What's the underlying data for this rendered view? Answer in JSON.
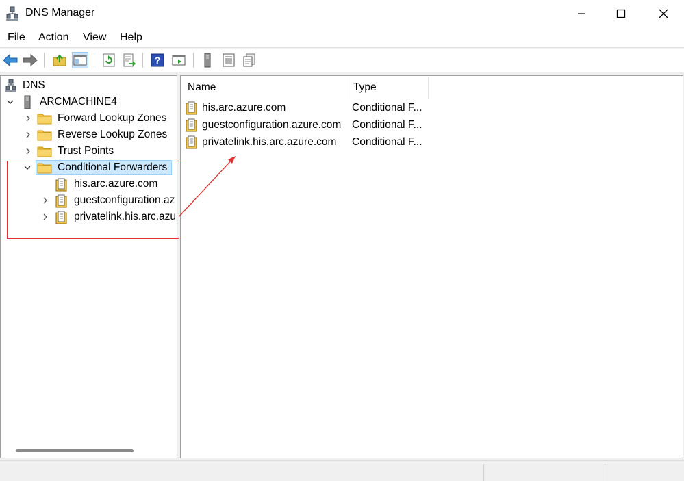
{
  "window": {
    "title": "DNS Manager",
    "controls": {
      "minimize": "—",
      "maximize": "☐",
      "close": "✕"
    }
  },
  "menu": [
    "File",
    "Action",
    "View",
    "Help"
  ],
  "toolbar": {
    "buttons": [
      "back-arrow-icon",
      "forward-arrow-icon",
      "up-folder-icon",
      "show-hide-tree-icon",
      "refresh-icon",
      "export-list-icon",
      "help-icon",
      "action-pane-icon",
      "server-icon",
      "list-icon",
      "properties-icon"
    ]
  },
  "tree": {
    "root": "DNS",
    "server": "ARCMACHINE4",
    "nodes": [
      "Forward Lookup Zones",
      "Reverse Lookup Zones",
      "Trust Points",
      "Conditional Forwarders"
    ],
    "forwarders": [
      "his.arc.azure.com",
      "guestconfiguration.az",
      "privatelink.his.arc.azur"
    ]
  },
  "list": {
    "columns": [
      "Name",
      "Type"
    ],
    "rows": [
      {
        "name": "his.arc.azure.com",
        "type": "Conditional F..."
      },
      {
        "name": "guestconfiguration.azure.com",
        "type": "Conditional F..."
      },
      {
        "name": "privatelink.his.arc.azure.com",
        "type": "Conditional F..."
      }
    ]
  },
  "colors": {
    "selection": "#cce8ff",
    "annotation": "#e03030",
    "folder": "#f5c542"
  }
}
